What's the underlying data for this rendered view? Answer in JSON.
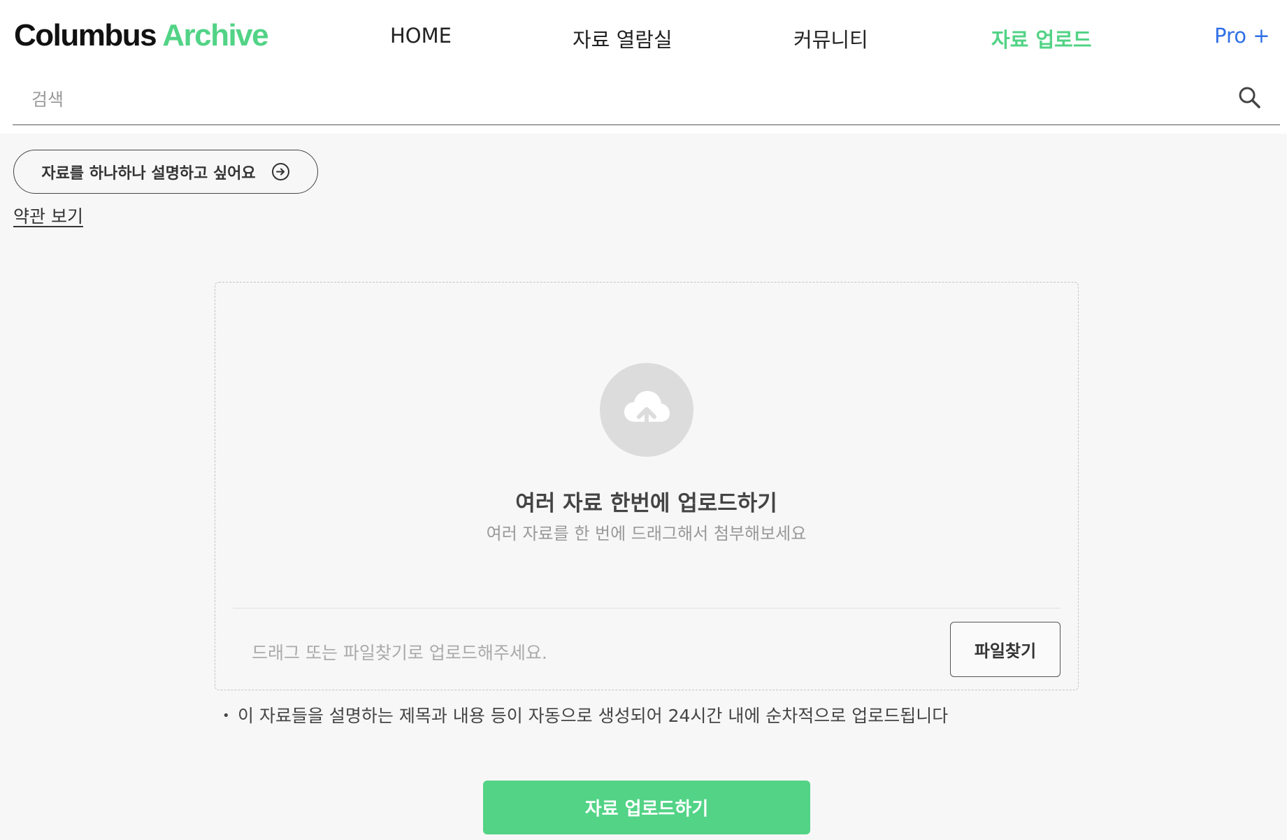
{
  "header": {
    "logo_main": "Columbus",
    "logo_accent": "Archive",
    "nav": {
      "home": "HOME",
      "reading_room": "자료 열람실",
      "community": "커뮤니티",
      "upload": "자료 업로드",
      "pro": "Pro +"
    }
  },
  "search": {
    "placeholder": "검색"
  },
  "actions": {
    "describe_each": "자료를 하나하나 설명하고 싶어요",
    "terms": "약관 보기"
  },
  "dropzone": {
    "title": "여러 자료 한번에 업로드하기",
    "subtitle": "여러 자료를 한 번에 드래그해서 첨부해보세요",
    "hint": "드래그 또는 파일찾기로 업로드해주세요.",
    "find_file": "파일찾기"
  },
  "note": {
    "bullet": "•",
    "text": "이 자료들을 설명하는 제목과 내용 등이 자동으로 생성되어 24시간 내에 순차적으로 업로드됩니다"
  },
  "submit_label": "자료 업로드하기",
  "colors": {
    "accent": "#52d386",
    "pro": "#2f6fe6",
    "background": "#f7f7f7"
  },
  "icons": [
    "circle-arrow-right-icon",
    "search-icon",
    "cloud-upload-icon"
  ]
}
